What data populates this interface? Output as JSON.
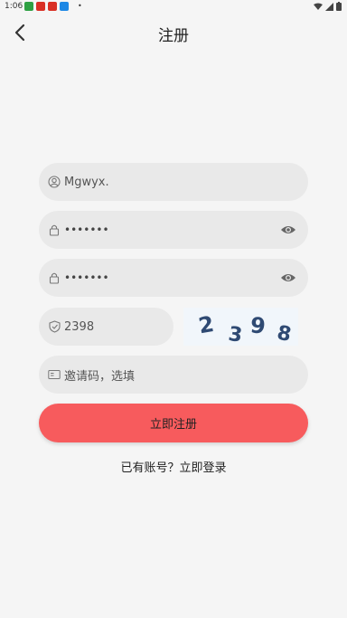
{
  "status_bar": {
    "time": "1:06",
    "notif_colors": [
      "#2ea043",
      "#d93025",
      "#d93025",
      "#1e88e5"
    ]
  },
  "header": {
    "title": "注册",
    "back_icon": "chevron-left-icon"
  },
  "form": {
    "username": {
      "value": "Mgwyx.",
      "icon": "user-circle-icon"
    },
    "password": {
      "value": "•••••••",
      "icon": "lock-icon",
      "toggle_icon": "eye-icon"
    },
    "confirm_password": {
      "value": "•••••••",
      "icon": "lock-icon",
      "toggle_icon": "eye-icon"
    },
    "captcha": {
      "value": "2398",
      "icon": "shield-check-icon",
      "image_text": "2398"
    },
    "invite_code": {
      "placeholder": "邀请码，选填",
      "icon": "id-card-icon"
    }
  },
  "actions": {
    "register_label": "立即注册",
    "login_link": "已有账号？立即登录"
  },
  "colors": {
    "accent": "#f75b5d",
    "field_bg": "#e9e9e9",
    "page_bg": "#f5f5f5"
  }
}
